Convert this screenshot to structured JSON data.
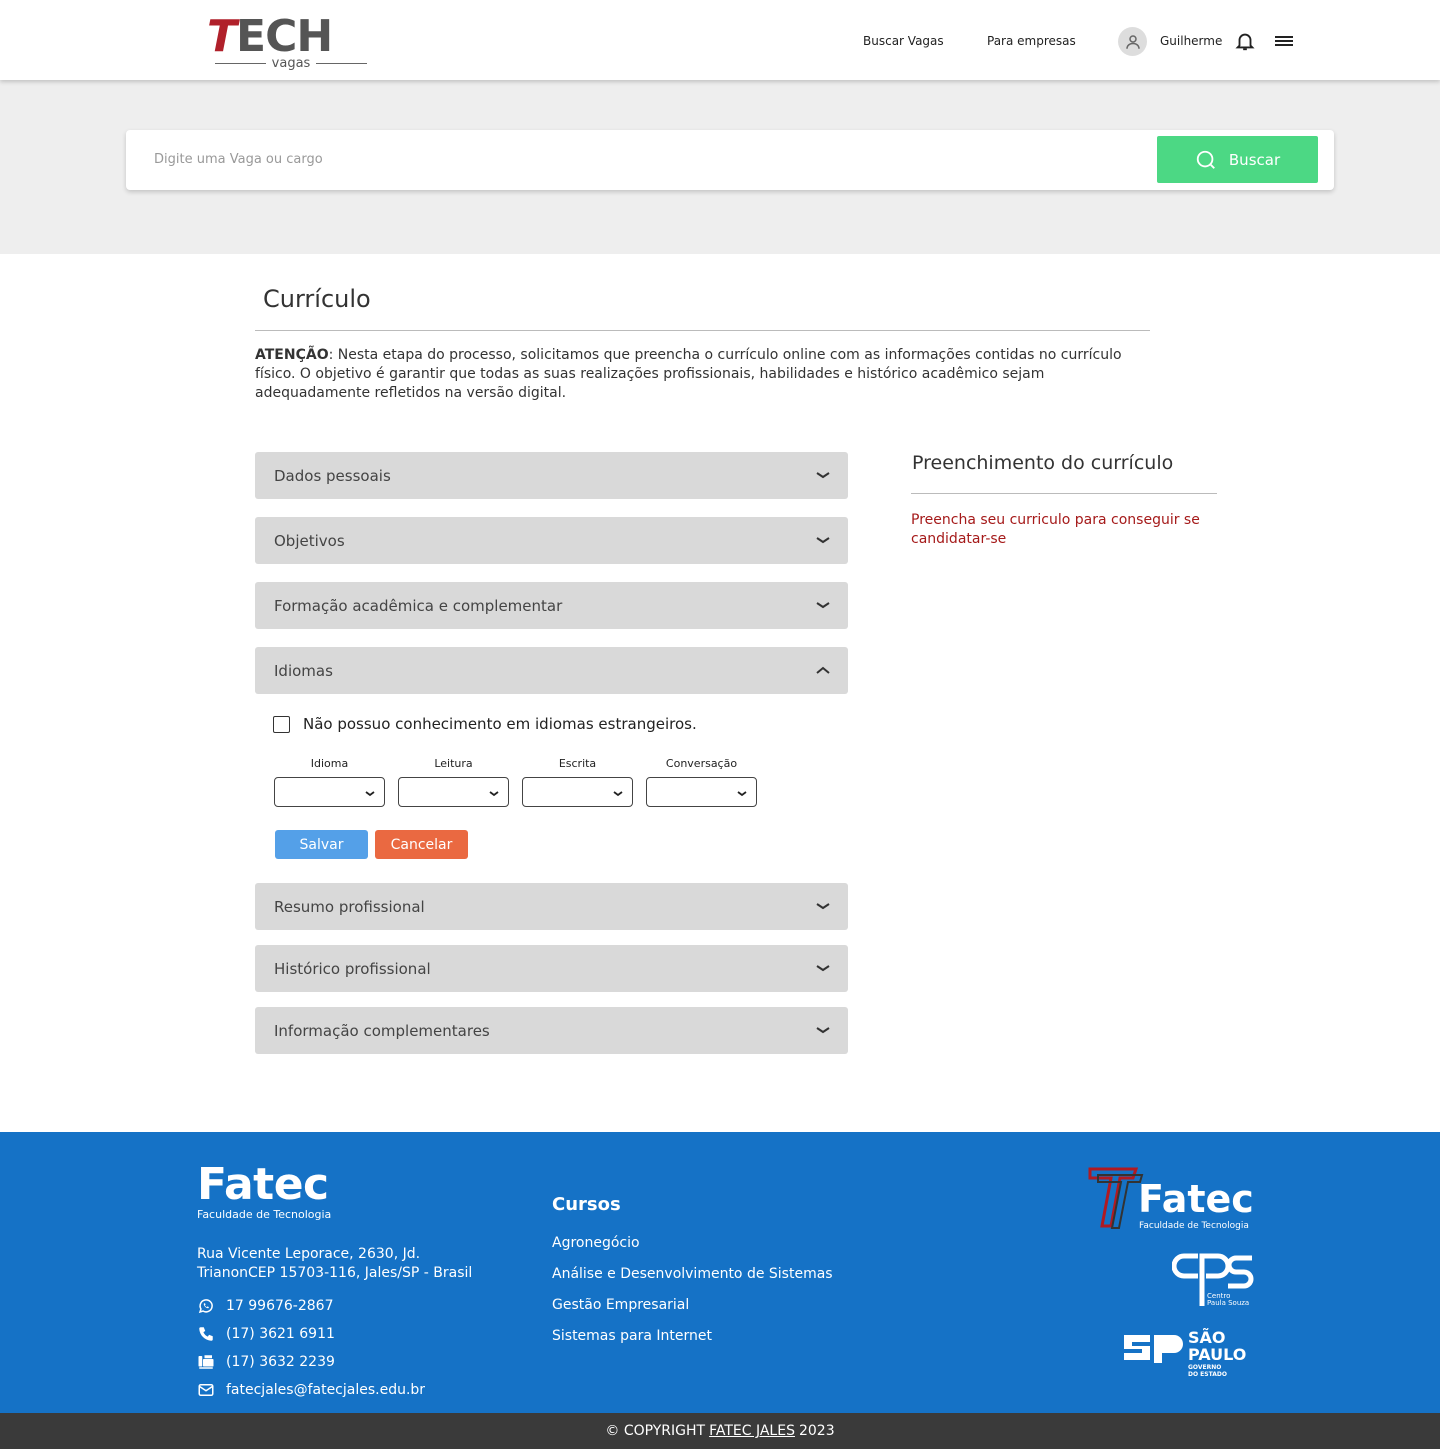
{
  "header": {
    "logo_main": "TECH",
    "logo_sub": "vagas",
    "nav_buscar": "Buscar Vagas",
    "nav_empresas": "Para empresas",
    "user_name": "Guilherme"
  },
  "search": {
    "placeholder": "Digite uma Vaga ou cargo",
    "button_label": "Buscar"
  },
  "main": {
    "title": "Currículo",
    "attention_label": "ATENÇÃO",
    "attention_text": ": Nesta etapa do processo, solicitamos que preencha o currículo online com as informações contidas no currículo físico. O objetivo é garantir que todas as suas realizações profissionais, habilidades e histórico acadêmico sejam adequadamente refletidos na versão digital.",
    "sections": [
      {
        "label": "Dados pessoais",
        "expanded": false
      },
      {
        "label": "Objetivos",
        "expanded": false
      },
      {
        "label": "Formação acadêmica e complementar",
        "expanded": false
      },
      {
        "label": "Idiomas",
        "expanded": true
      },
      {
        "label": "Resumo profissional",
        "expanded": false
      },
      {
        "label": "Histórico profissional",
        "expanded": false
      },
      {
        "label": "Informação complementares",
        "expanded": false
      }
    ],
    "idiomas": {
      "no_language_label": "Não possuo conhecimento em idiomas estrangeiros.",
      "no_language_checked": false,
      "columns": [
        "Idioma",
        "Leitura",
        "Escrita",
        "Conversação"
      ],
      "save_label": "Salvar",
      "cancel_label": "Cancelar"
    }
  },
  "sidebar": {
    "title": "Preenchimento do currículo",
    "message": "Preencha seu curriculo para conseguir se candidatar-se"
  },
  "footer": {
    "logo_name": "Fatec",
    "logo_tagline": "Faculdade de Tecnologia",
    "address": "Rua Vicente Leporace, 2630, Jd. TrianonCEP 15703-116, Jales/SP - Brasil",
    "whatsapp": "17 99676-2867",
    "phone": "(17) 3621 6911",
    "fax": "(17) 3632 2239",
    "email": "fatecjales@fatecjales.edu.br",
    "courses_title": "Cursos",
    "courses": [
      "Agronegócio",
      "Análise e Desenvolvimento de Sistemas",
      "Gestão Empresarial",
      "Sistemas para Internet"
    ],
    "partner_fatec_name": "Fatec",
    "partner_fatec_tagline": "Faculdade de Tecnologia",
    "partner_cps_name": "Centro Paula Souza",
    "partner_sp_name": "SÃO PAULO",
    "partner_sp_sub": "GOVERNO DO ESTADO"
  },
  "copyright": {
    "prefix": "© COPYRIGHT",
    "link": "FATEC JALES",
    "year": "2023"
  },
  "colors": {
    "accent_green": "#4cd884",
    "save_blue": "#54a0e8",
    "cancel_orange": "#ea6941",
    "footer_blue": "#1572c6",
    "alert_red": "#a51a1a"
  }
}
